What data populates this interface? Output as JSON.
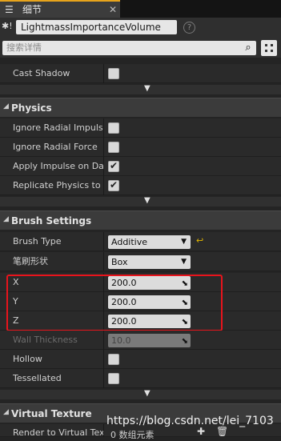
{
  "tab": {
    "title": "细节"
  },
  "header": {
    "actor_name": "LightmassImportanceVolume",
    "search_placeholder": "搜索详情"
  },
  "rendering_partial": {
    "cast_shadow": {
      "label": "Cast Shadow",
      "checked": false
    }
  },
  "physics": {
    "title": "Physics",
    "rows": [
      {
        "label": "Ignore Radial Impulse",
        "checked": false
      },
      {
        "label": "Ignore Radial Force",
        "checked": false
      },
      {
        "label": "Apply Impulse on Damage",
        "checked": true
      },
      {
        "label": "Replicate Physics to Autonomous Proxy",
        "checked": true
      }
    ]
  },
  "brush": {
    "title": "Brush Settings",
    "brush_type": {
      "label": "Brush Type",
      "value": "Additive"
    },
    "shape": {
      "label": "笔刷形状",
      "value": "Box"
    },
    "x": {
      "label": "X",
      "value": "200.0"
    },
    "y": {
      "label": "Y",
      "value": "200.0"
    },
    "z": {
      "label": "Z",
      "value": "200.0"
    },
    "wall": {
      "label": "Wall Thickness",
      "value": "10.0"
    },
    "hollow": {
      "label": "Hollow",
      "checked": false
    },
    "tessellated": {
      "label": "Tessellated",
      "checked": false
    }
  },
  "virtual_texture": {
    "title": "Virtual Texture",
    "row": {
      "label": "Render to Virtual Textures",
      "value": "0 数组元素"
    }
  },
  "watermark": "https://blog.csdn.net/lei_7103",
  "colors": {
    "accent": "#e8a41c",
    "highlight": "#e8141c"
  }
}
